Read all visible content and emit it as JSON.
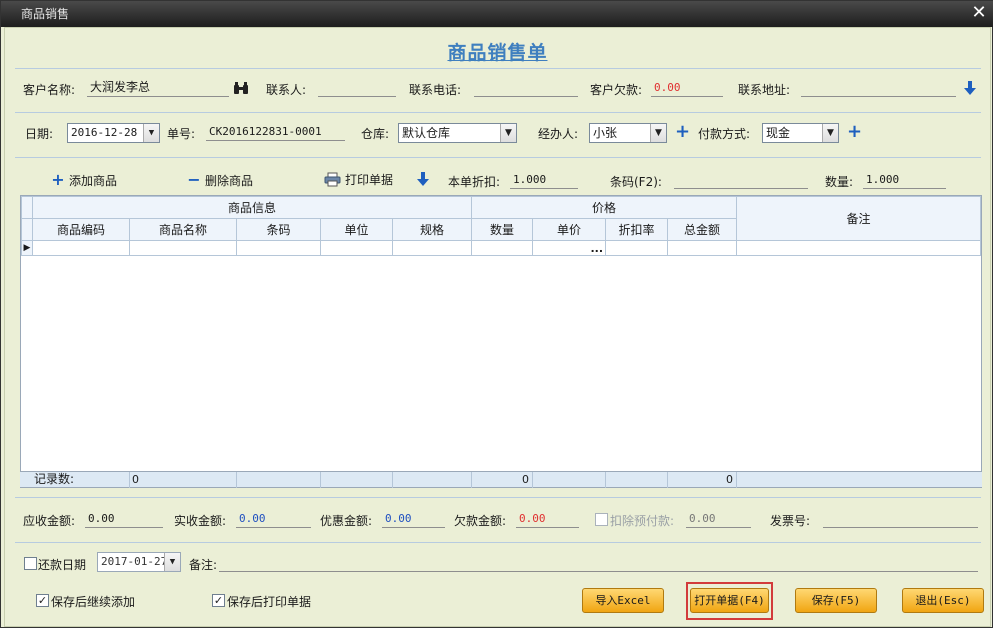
{
  "window": {
    "title": "商品销售",
    "close_glyph": "✕"
  },
  "heading": "商品销售单",
  "customer": {
    "name_label": "客户名称:",
    "name_value": "大润发李总",
    "contact_label": "联系人:",
    "contact_value": "",
    "phone_label": "联系电话:",
    "phone_value": "",
    "debt_label": "客户欠款:",
    "debt_value": "0.00",
    "address_label": "联系地址:",
    "address_value": ""
  },
  "order": {
    "date_label": "日期:",
    "date_value": "2016-12-28",
    "number_label": "单号:",
    "number_value": "CK2016122831-0001",
    "warehouse_label": "仓库:",
    "warehouse_value": "默认仓库",
    "handler_label": "经办人:",
    "handler_value": "小张",
    "payment_label": "付款方式:",
    "payment_value": "现金"
  },
  "toolbar": {
    "add_label": "添加商品",
    "delete_label": "删除商品",
    "print_label": "打印单据",
    "discount_label": "本单折扣:",
    "discount_value": "1.000",
    "barcode_label": "条码(F2):",
    "barcode_value": "",
    "qty_label": "数量:",
    "qty_value": "1.000"
  },
  "grid": {
    "group_product": "商品信息",
    "group_price": "价格",
    "notes_header": "备注",
    "columns": [
      "商品编码",
      "商品名称",
      "条码",
      "单位",
      "规格",
      "数量",
      "单价",
      "折扣率",
      "总金额"
    ],
    "ellipsis": "...",
    "footer_label": "记录数:",
    "footer_count": "0",
    "footer_qty_total": "0",
    "footer_amount_total": "0"
  },
  "totals": {
    "receivable_label": "应收金额:",
    "receivable_value": "0.00",
    "received_label": "实收金额:",
    "received_value": "0.00",
    "discount_label": "优惠金额:",
    "discount_value": "0.00",
    "owed_label": "欠款金额:",
    "owed_value": "0.00",
    "prepay_label": "扣除预付款:",
    "prepay_value": "0.00",
    "invoice_label": "发票号:",
    "invoice_value": ""
  },
  "repay": {
    "date_label": "还款日期",
    "date_value": "2017-01-27",
    "note_label": "备注:",
    "note_value": ""
  },
  "options": {
    "continue_label": "保存后继续添加",
    "print_after_label": "保存后打印单据"
  },
  "buttons": {
    "import": "导入Excel",
    "open": "打开单据(F4)",
    "save": "保存(F5)",
    "exit": "退出(Esc)"
  },
  "colors": {
    "accent": "#3f7fbf",
    "negative_value": "#e03030",
    "value_blue": "#2050c0",
    "button": "#f0a512"
  }
}
